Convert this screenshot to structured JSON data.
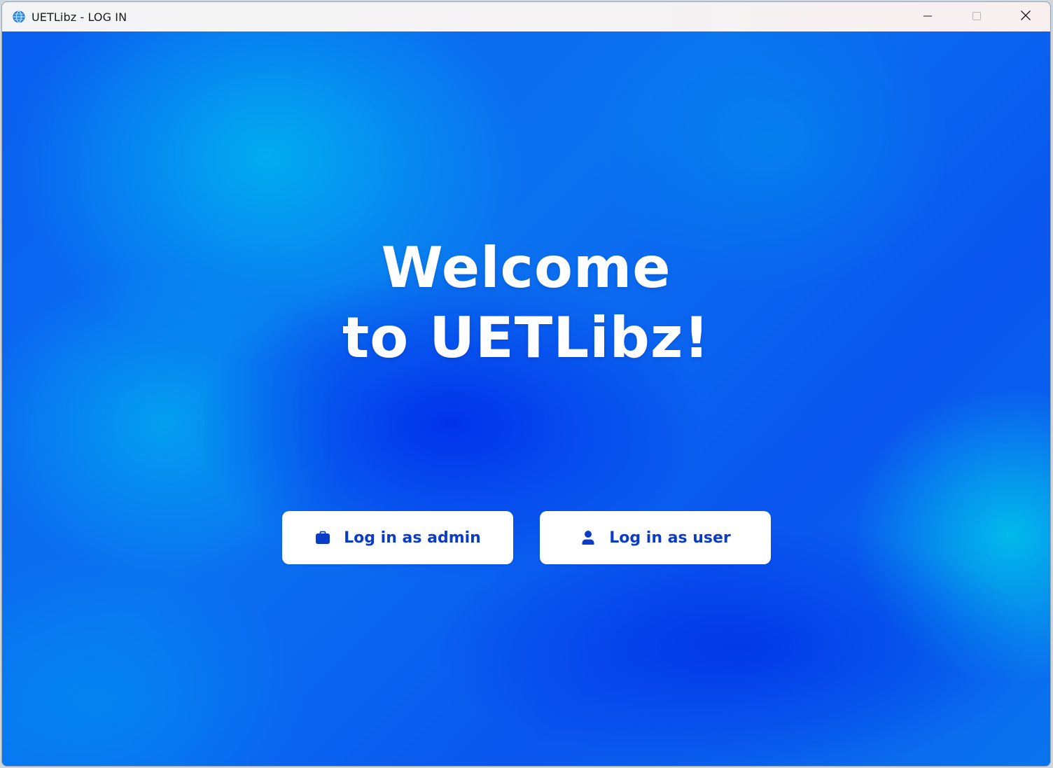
{
  "window": {
    "title": "UETLibz - LOG IN",
    "app_icon": "globe-icon",
    "controls": {
      "minimize_icon": "minimize-icon",
      "maximize_icon": "maximize-icon",
      "close_icon": "close-icon"
    }
  },
  "main": {
    "welcome_line1": "Welcome",
    "welcome_line2": "to UETLibz!",
    "admin_button": {
      "label": "Log in as admin",
      "icon": "briefcase-icon"
    },
    "user_button": {
      "label": "Log in as user",
      "icon": "person-icon"
    }
  },
  "colors": {
    "accent": "#0a3cc8",
    "background_primary": "#0a5ef0",
    "background_light": "#00b4f0",
    "button_bg": "#ffffff",
    "text_white": "#ffffff"
  }
}
